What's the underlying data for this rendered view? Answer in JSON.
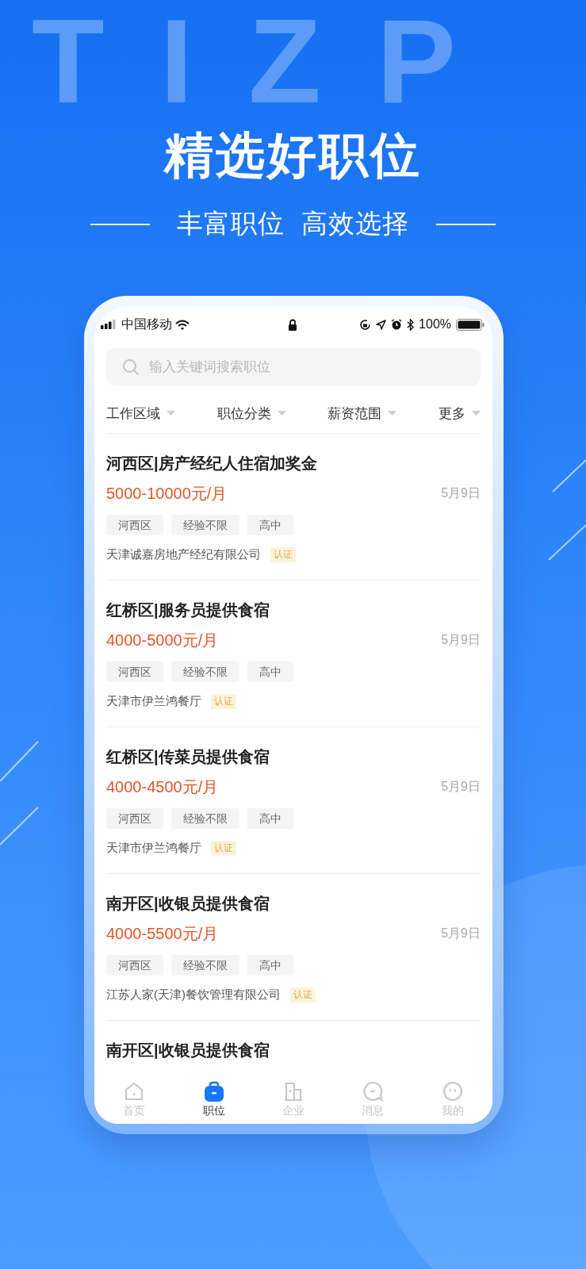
{
  "backdrop_text": "TIZP",
  "headline": "精选好职位",
  "subtitle": "丰富职位  高效选择",
  "status_bar": {
    "carrier": "中国移动",
    "battery": "100%"
  },
  "search": {
    "placeholder": "输入关键词搜索职位"
  },
  "filters": [
    "工作区域",
    "职位分类",
    "薪资范围",
    "更多"
  ],
  "jobs": [
    {
      "title": "河西区|房产经纪人住宿加奖金",
      "salary": "5000-10000元/月",
      "date": "5月9日",
      "tags": [
        "河西区",
        "经验不限",
        "高中"
      ],
      "company": "天津诚嘉房地产经纪有限公司",
      "badge": "认证"
    },
    {
      "title": "红桥区|服务员提供食宿",
      "salary": "4000-5000元/月",
      "date": "5月9日",
      "tags": [
        "河西区",
        "经验不限",
        "高中"
      ],
      "company": "天津市伊兰鸿餐厅",
      "badge": "认证"
    },
    {
      "title": "红桥区|传菜员提供食宿",
      "salary": "4000-4500元/月",
      "date": "5月9日",
      "tags": [
        "河西区",
        "经验不限",
        "高中"
      ],
      "company": "天津市伊兰鸿餐厅",
      "badge": "认证"
    },
    {
      "title": "南开区|收银员提供食宿",
      "salary": "4000-5500元/月",
      "date": "5月9日",
      "tags": [
        "河西区",
        "经验不限",
        "高中"
      ],
      "company": "江苏人家(天津)餐饮管理有限公司",
      "badge": "认证"
    },
    {
      "title": "南开区|收银员提供食宿"
    }
  ],
  "tabs": [
    {
      "label": "首页",
      "kind": "home",
      "selected": false
    },
    {
      "label": "职位",
      "kind": "bag",
      "selected": true
    },
    {
      "label": "企业",
      "kind": "building",
      "selected": false
    },
    {
      "label": "消息",
      "kind": "chat",
      "selected": false
    },
    {
      "label": "我的",
      "kind": "face",
      "selected": false
    }
  ]
}
